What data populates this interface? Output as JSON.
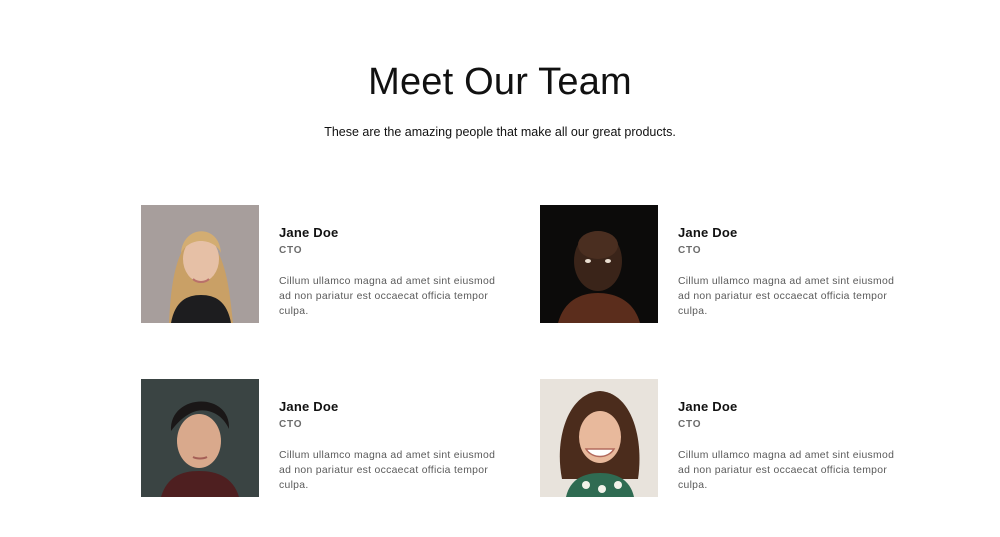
{
  "header": {
    "title": "Meet Our Team",
    "subtitle": "These are the amazing people that make all our great products."
  },
  "members": [
    {
      "name": "Jane Doe",
      "role": "CTO",
      "bio": "Cillum ullamco magna ad amet sint eiusmod ad non pariatur est occaecat officia tempor culpa."
    },
    {
      "name": "Jane Doe",
      "role": "CTO",
      "bio": "Cillum ullamco magna ad amet sint eiusmod ad non pariatur est occaecat officia tempor culpa."
    },
    {
      "name": "Jane Doe",
      "role": "CTO",
      "bio": "Cillum ullamco magna ad amet sint eiusmod ad non pariatur est occaecat officia tempor culpa."
    },
    {
      "name": "Jane Doe",
      "role": "CTO",
      "bio": "Cillum ullamco magna ad amet sint eiusmod ad non pariatur est occaecat officia tempor culpa."
    }
  ]
}
